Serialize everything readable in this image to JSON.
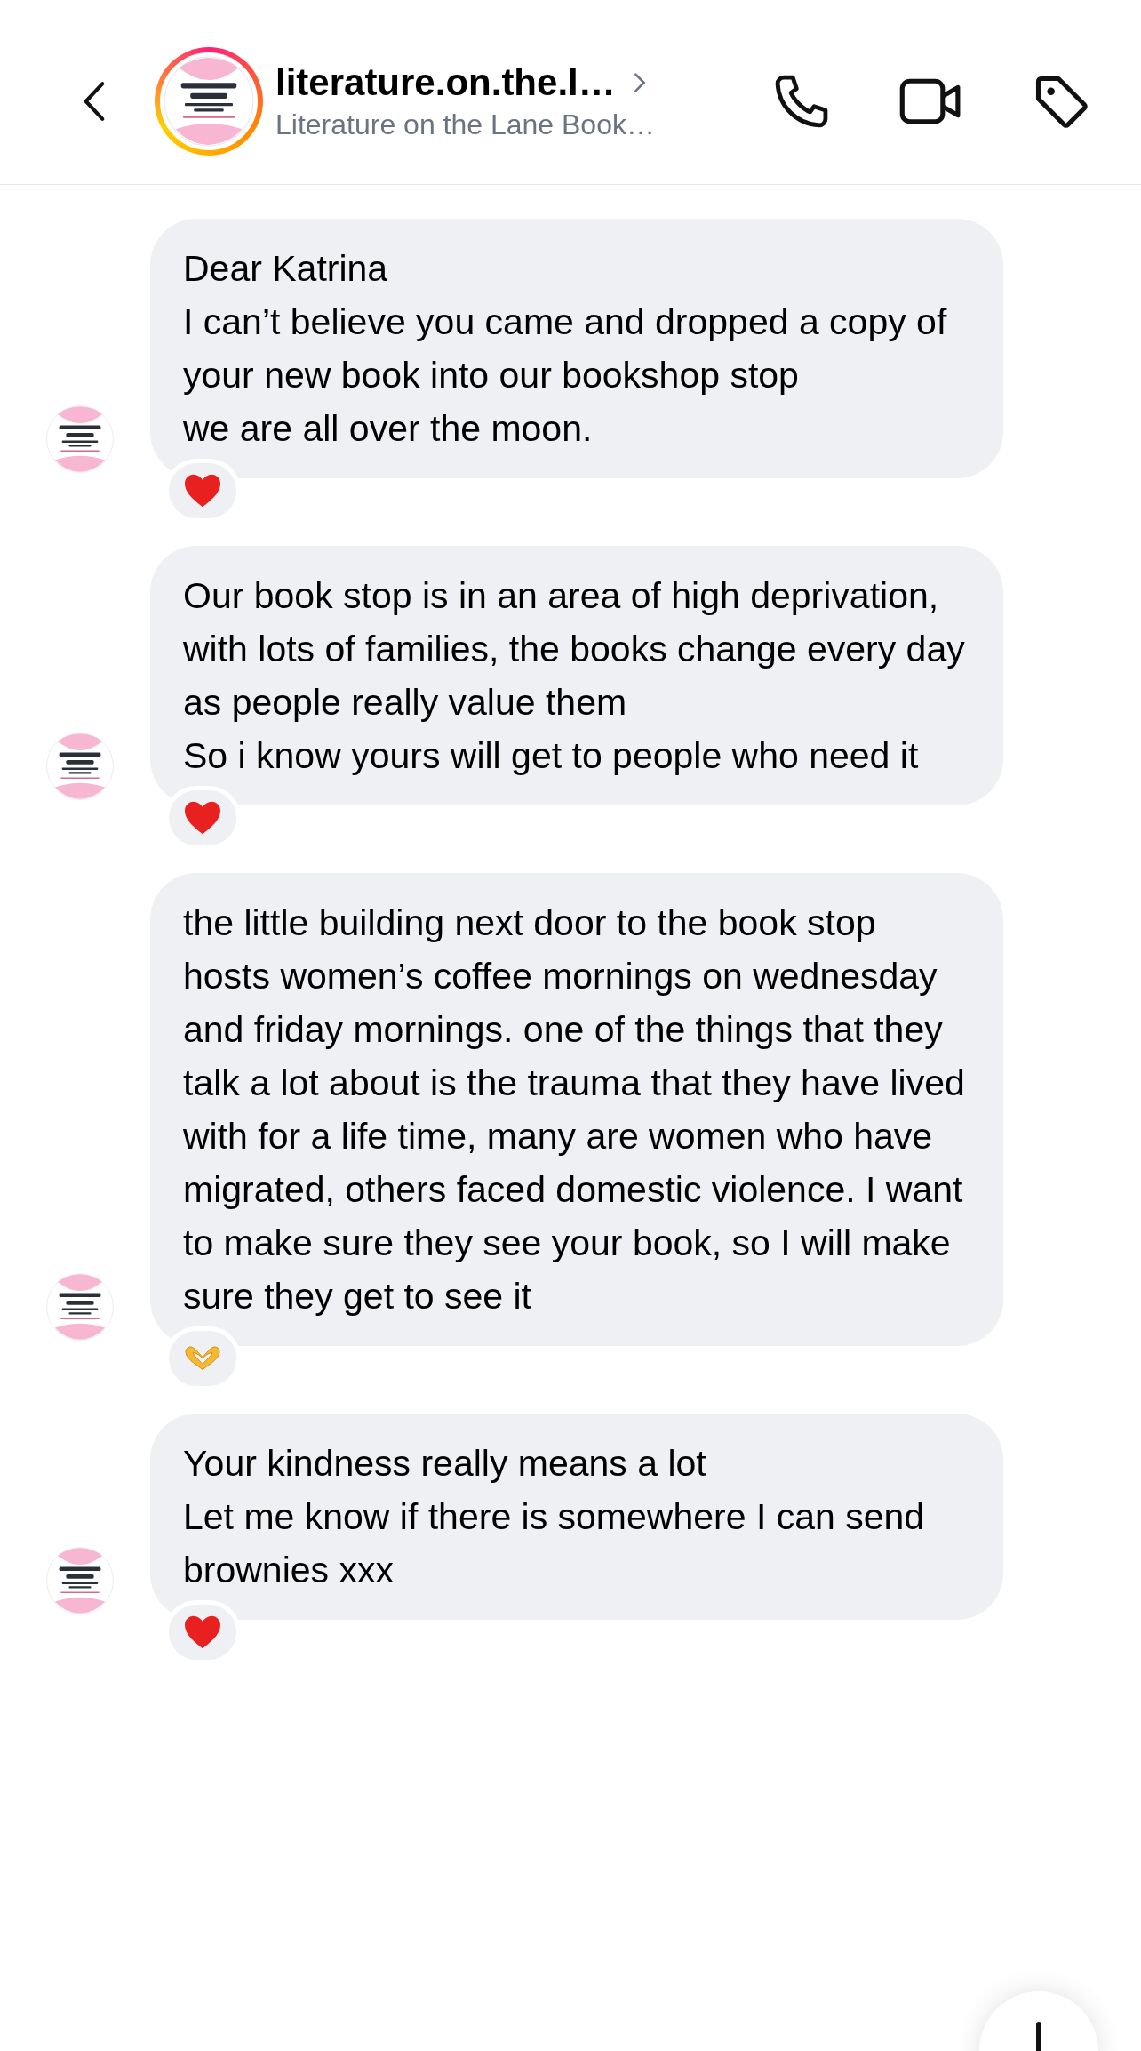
{
  "header": {
    "username": "literature.on.the.l…",
    "subtitle": "Literature on the Lane Book…"
  },
  "messages": [
    {
      "text": "Dear Katrina\nI can’t believe you came and dropped a copy of your new book into our bookshop stop\nwe are all over the moon.",
      "reaction": {
        "kind": "heart"
      }
    },
    {
      "text": "Our book stop is in an area of high deprivation, with lots of families, the books change every day as people really value them\nSo i know yours will get to people who need it",
      "reaction": {
        "kind": "heart"
      }
    },
    {
      "text": "the little building next door to the book stop hosts women’s coffee mornings on wednesday and friday mornings. one of the things that they talk a lot about is the trauma that they have lived with for a life time, many are women who have migrated, others faced domestic violence. I want to make sure they see your book, so I will make sure they get to see it",
      "reaction": {
        "kind": "heart_hands"
      }
    },
    {
      "text": "Your kindness really means a lot\nLet me know if there is somewhere I can send brownies xxx",
      "reaction": {
        "kind": "heart"
      }
    }
  ]
}
